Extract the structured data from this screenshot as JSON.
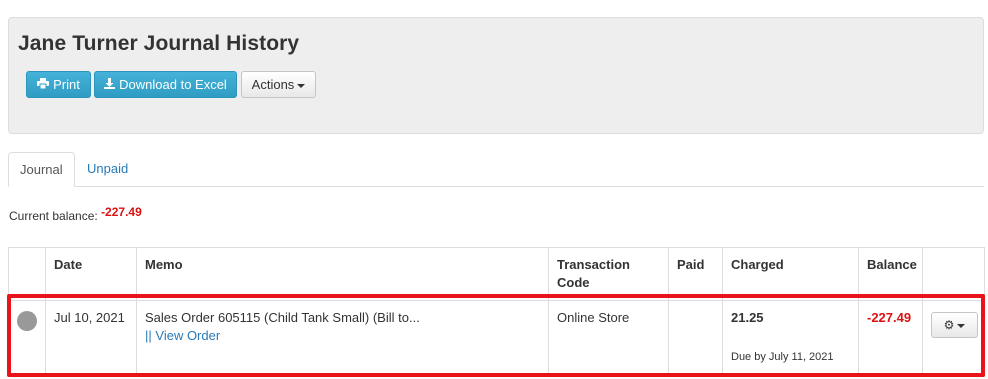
{
  "header": {
    "title": "Jane Turner Journal History",
    "buttons": {
      "print": "Print",
      "download": "Download to Excel",
      "actions": "Actions"
    }
  },
  "tabs": [
    {
      "label": "Journal",
      "active": true
    },
    {
      "label": "Unpaid",
      "active": false
    }
  ],
  "balance": {
    "label": "Current balance:",
    "value": "-227.49"
  },
  "table": {
    "columns": [
      "",
      "Date",
      "Memo",
      "Transaction Code",
      "Paid",
      "Charged",
      "Balance",
      ""
    ],
    "rows": [
      {
        "date": "Jul 10, 2021",
        "memo": "Sales Order 605115 (Child Tank Small) (Bill to...",
        "memo_sep": "||",
        "memo_link": "View Order",
        "transaction_code": "Online Store",
        "paid": "",
        "charged": "21.25",
        "due": "Due by July 11, 2021",
        "balance": "-227.49"
      }
    ]
  },
  "icons": {
    "print": "print-icon",
    "download": "download-icon",
    "gear": "gear-icon",
    "status": "status-dot-icon"
  },
  "colors": {
    "primary_button": "#3aa8cf",
    "link": "#2a7ab5",
    "negative": "#dd1111",
    "highlight": "#e8141a"
  }
}
